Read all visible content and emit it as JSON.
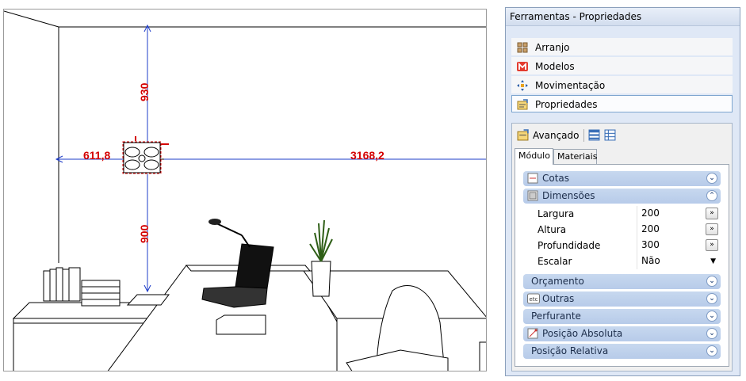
{
  "viewport": {
    "dimensions": {
      "left": "611,8",
      "right": "3168,2",
      "top": "930",
      "bottom": "900"
    },
    "colors": {
      "dimension": "#d40000",
      "dim_line": "#1e3cc8"
    }
  },
  "panel": {
    "title": "Ferramentas - Propriedades",
    "nav": [
      {
        "label": "Arranjo",
        "icon": "grid-icon"
      },
      {
        "label": "Modelos",
        "icon": "m-logo-icon"
      },
      {
        "label": "Movimentação",
        "icon": "move-arrows-icon"
      },
      {
        "label": "Propriedades",
        "icon": "properties-icon",
        "active": true
      }
    ],
    "toolbar": {
      "label": "Avançado"
    },
    "tabs": [
      "Módulo",
      "Materiais"
    ],
    "sections": {
      "cotas": "Cotas",
      "dimensoes": "Dimensões",
      "orcamento": "Orçamento",
      "outras": "Outras",
      "perfurante": "Perfurante",
      "posicao_absoluta": "Posição Absoluta",
      "posicao_relativa": "Posição Relativa"
    },
    "properties": [
      {
        "name": "Largura",
        "value": "200"
      },
      {
        "name": "Altura",
        "value": "200"
      },
      {
        "name": "Profundidade",
        "value": "300"
      },
      {
        "name": "Escalar",
        "value": "Não"
      }
    ],
    "colors": {
      "accent": "#7ea6cf",
      "section": "#bfd1ec"
    }
  }
}
